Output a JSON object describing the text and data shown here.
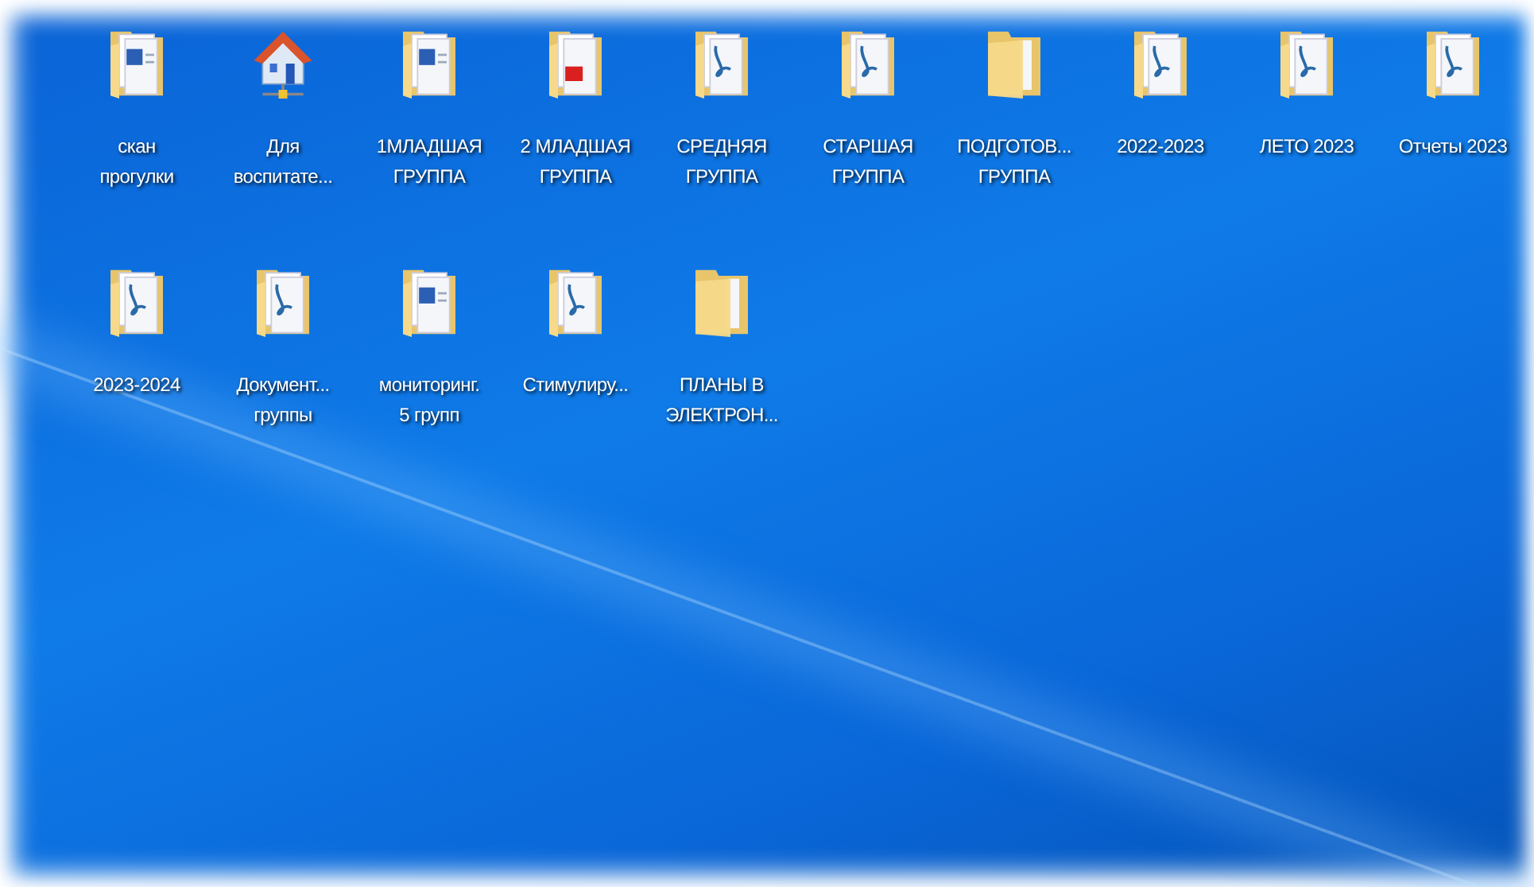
{
  "desktop_icons": [
    {
      "kind": "word",
      "lines": [
        "скан",
        "прогулки"
      ]
    },
    {
      "kind": "network",
      "lines": [
        "Для",
        "воспитате..."
      ]
    },
    {
      "kind": "word",
      "lines": [
        "1МЛАДШАЯ",
        "ГРУППА"
      ]
    },
    {
      "kind": "pdf",
      "lines": [
        "2 МЛАДШАЯ",
        "ГРУППА"
      ]
    },
    {
      "kind": "acrobat",
      "lines": [
        "СРЕДНЯЯ",
        "ГРУППА"
      ]
    },
    {
      "kind": "acrobat",
      "lines": [
        "СТАРШАЯ",
        "ГРУППА"
      ]
    },
    {
      "kind": "plain",
      "lines": [
        "ПОДГОТОВ...",
        "ГРУППА"
      ]
    },
    {
      "kind": "acrobat",
      "lines": [
        "2022-2023"
      ]
    },
    {
      "kind": "acrobat",
      "lines": [
        "ЛЕТО 2023"
      ]
    },
    {
      "kind": "acrobat",
      "lines": [
        "Отчеты 2023"
      ]
    },
    {
      "kind": "acrobat",
      "lines": [
        "2023-2024"
      ]
    },
    {
      "kind": "acrobat",
      "lines": [
        "Документ...",
        "группы"
      ]
    },
    {
      "kind": "word",
      "lines": [
        "мониторинг.",
        "5 групп"
      ]
    },
    {
      "kind": "acrobat",
      "lines": [
        "Стимулиру..."
      ]
    },
    {
      "kind": "plain",
      "lines": [
        "ПЛАНЫ В",
        "ЭЛЕКТРОН..."
      ]
    }
  ]
}
